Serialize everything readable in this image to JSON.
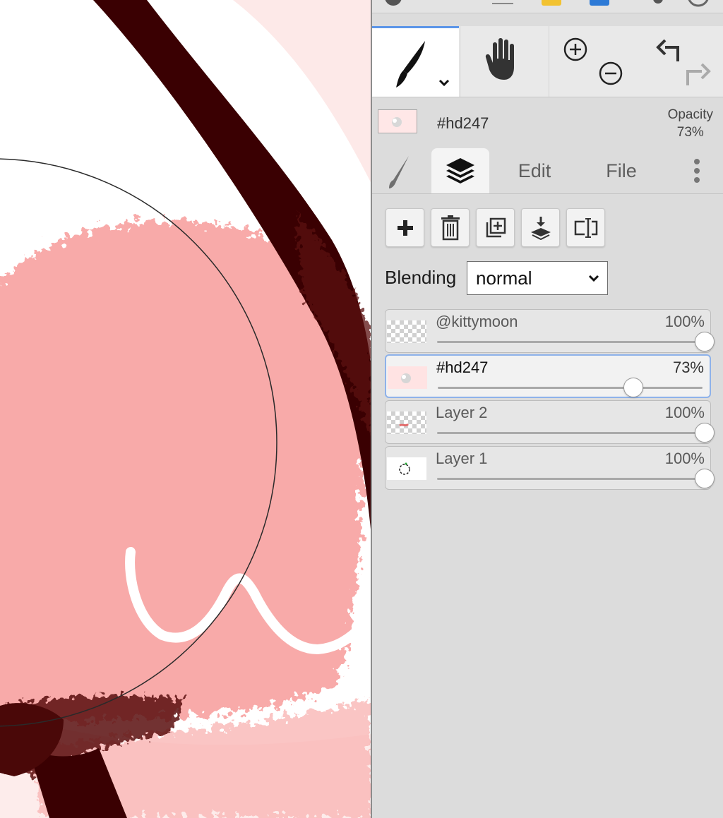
{
  "colors": {
    "accent": "#5b95e8",
    "canvas_pink": "#f7a9a8",
    "stroke_dark": "#3a0002",
    "panel_bg": "#dcdcdc"
  },
  "toolbar": {
    "tools": [
      {
        "name": "brush",
        "icon": "brush-icon",
        "selected": true
      },
      {
        "name": "hand",
        "icon": "hand-icon"
      },
      {
        "name": "zoom",
        "icons": [
          "zoom-in-icon",
          "zoom-out-icon"
        ]
      },
      {
        "name": "history",
        "icons": [
          "undo-icon",
          "redo-icon"
        ]
      }
    ]
  },
  "color_bar": {
    "color_name": "#hd247",
    "opacity_label": "Opacity",
    "opacity_value": "73%"
  },
  "tabs": {
    "brush_icon": "brush-icon",
    "layers_icon": "layers-icon",
    "edit": "Edit",
    "file": "File",
    "more_icon": "more-vertical-icon"
  },
  "layer_actions": [
    "add-layer-icon",
    "delete-layer-icon",
    "duplicate-layer-icon",
    "merge-down-icon",
    "rename-layer-icon"
  ],
  "blending": {
    "label": "Blending",
    "value": "normal"
  },
  "layers": [
    {
      "name": "@kittymoon",
      "opacity": "100%",
      "level": 1.0,
      "active": false
    },
    {
      "name": "#hd247",
      "opacity": "73%",
      "level": 0.73,
      "active": true
    },
    {
      "name": "Layer 2",
      "opacity": "100%",
      "level": 1.0,
      "active": false
    },
    {
      "name": "Layer 1",
      "opacity": "100%",
      "level": 1.0,
      "active": false
    }
  ]
}
